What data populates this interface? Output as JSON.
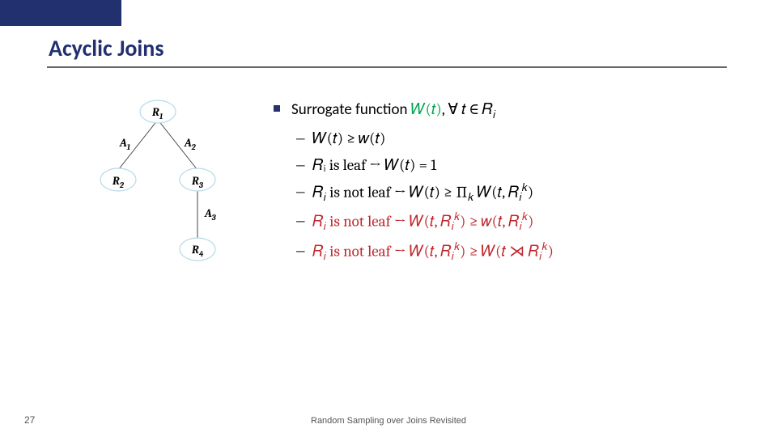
{
  "title": "Acyclic Joins",
  "page_number": "27",
  "footer": "Random Sampling over Joins Revisited",
  "tree": {
    "nodes": [
      "R",
      "R",
      "R",
      "R"
    ],
    "subs": [
      "1",
      "2",
      "3",
      "4"
    ],
    "edges": [
      "A",
      "A",
      "A"
    ],
    "edge_subs": [
      "1",
      "2",
      "3"
    ]
  },
  "bullet": {
    "label_plain": "Surrogate function ",
    "wt": "𝑊(𝑡)",
    "forall": ", ∀ 𝑡 ∈ 𝑅",
    "ri_sub": "𝑖"
  },
  "items": [
    {
      "lhs": "𝑊(𝑡) ≥ 𝑤(𝑡)",
      "red": false
    },
    {
      "lhs": "𝑅ᵢ is leaf  →  𝑊(𝑡) = 1",
      "red": false
    },
    {
      "lhs_a": "𝑅",
      "lhs_sub": "𝑖",
      "lhs_b": " is not leaf → 𝑊(𝑡) ≥ ∏",
      "prod_sub": "𝑘",
      "lhs_c": " 𝑊(𝑡, 𝑅",
      "rk_sub": "𝑖",
      "rk_sup": "𝑘",
      "lhs_d": ")",
      "red": false,
      "complex": true
    },
    {
      "lhs_a": "𝑅",
      "lhs_sub": "𝑖",
      "lhs_b": " is not leaf → 𝑊(𝑡, 𝑅",
      "rk_sub": "𝑖",
      "rk_sup": "𝑘",
      "lhs_c": ") ≥ 𝑤(𝑡, 𝑅",
      "rk2_sub": "𝑖",
      "rk2_sup": "𝑘",
      "lhs_d": ")",
      "red": true,
      "complex": true
    },
    {
      "lhs_a": "𝑅",
      "lhs_sub": "𝑖",
      "lhs_b": " is not leaf → 𝑊(𝑡, 𝑅",
      "rk_sub": "𝑖",
      "rk_sup": "𝑘",
      "lhs_c": ") ≥ 𝑊(𝑡 ⋊ 𝑅",
      "rk2_sub": "𝑖",
      "rk2_sup": "𝑘",
      "lhs_d": ")",
      "red": true,
      "complex": true
    }
  ]
}
